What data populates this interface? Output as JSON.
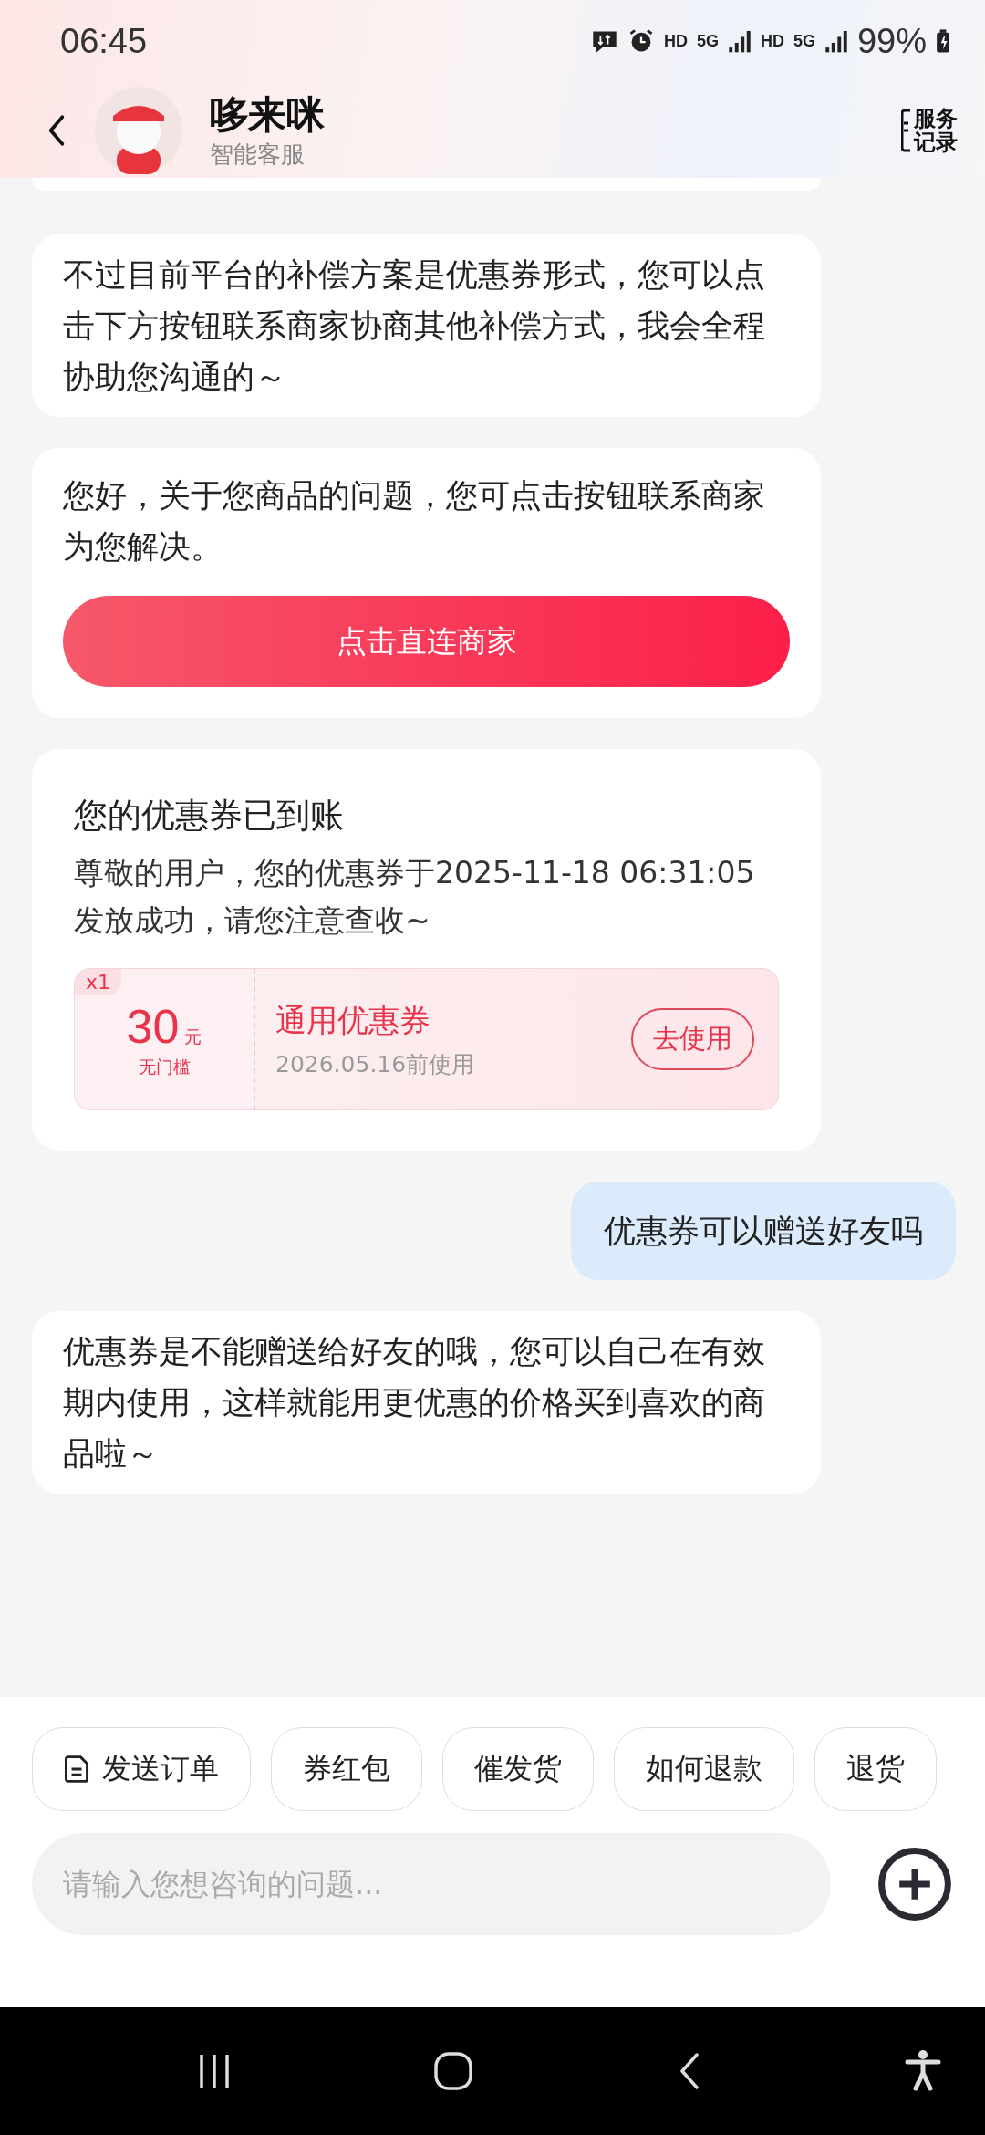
{
  "status_bar": {
    "time": "06:45",
    "network_labels": [
      "HD",
      "5G",
      "HD",
      "5G"
    ],
    "battery": "99%"
  },
  "header": {
    "title": "哆来咪",
    "subtitle": "智能客服",
    "record_button": "服务记录"
  },
  "messages": [
    {
      "kind": "bot_text",
      "text": "不过目前平台的补偿方案是优惠券形式，您可以点击下方按钮联系商家协商其他补偿方式，我会全程协助您沟通的～"
    },
    {
      "kind": "bot_action",
      "text": "您好，关于您商品的问题，您可点击按钮联系商家为您解决。",
      "button": "点击直连商家"
    },
    {
      "kind": "coupon",
      "title": "您的优惠券已到账",
      "text": "尊敬的用户，您的优惠券于2025-11-18 06:31:05发放成功，请您注意查收~",
      "coupon": {
        "count": "x1",
        "amount": "30",
        "unit": "元",
        "condition": "无门槛",
        "name": "通用优惠券",
        "validity": "2026.05.16前使用",
        "button": "去使用"
      }
    },
    {
      "kind": "user_text",
      "text": "优惠券可以赠送好友吗"
    },
    {
      "kind": "bot_text",
      "text": "优惠券是不能赠送给好友的哦，您可以自己在有效期内使用，这样就能用更优惠的价格买到喜欢的商品啦～"
    }
  ],
  "quick_replies": [
    {
      "kind": "order",
      "label": "发送订单"
    },
    {
      "kind": "plain",
      "label": "券红包"
    },
    {
      "kind": "plain",
      "label": "催发货"
    },
    {
      "kind": "plain",
      "label": "如何退款"
    },
    {
      "kind": "plain",
      "label": "退货"
    }
  ],
  "input": {
    "placeholder": "请输入您想咨询的问题..."
  }
}
